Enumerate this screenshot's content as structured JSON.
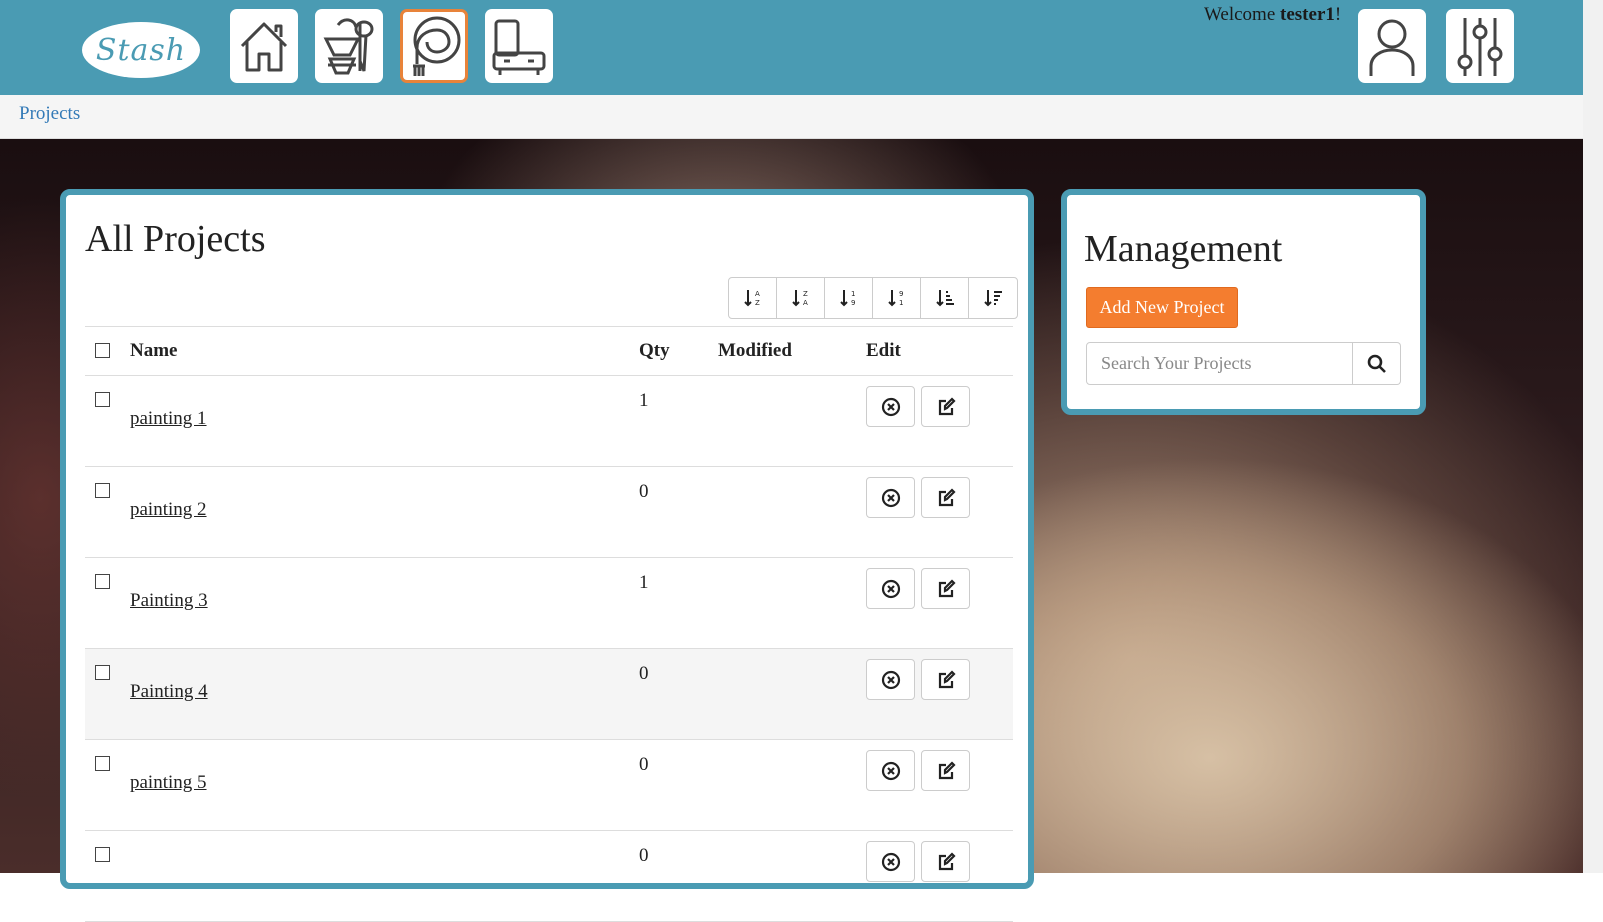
{
  "header": {
    "logo_text": "Stash",
    "nav": [
      {
        "icon": "home-icon",
        "active": false
      },
      {
        "icon": "sewing-supplies-icon",
        "active": false
      },
      {
        "icon": "projects-pattern-icon",
        "active": true
      },
      {
        "icon": "storage-cabinet-icon",
        "active": false
      }
    ],
    "welcome_prefix": "Welcome ",
    "username": "tester1",
    "welcome_suffix": "!",
    "profile_icon": "user-profile-icon",
    "settings_icon": "settings-sliders-icon"
  },
  "breadcrumb": {
    "current": "Projects"
  },
  "projects": {
    "title": "All Projects",
    "sort_buttons": [
      "sort-alpha-asc-icon",
      "sort-alpha-desc-icon",
      "sort-numeric-asc-icon",
      "sort-numeric-desc-icon",
      "sort-amount-asc-icon",
      "sort-amount-desc-icon"
    ],
    "columns": {
      "name": "Name",
      "qty": "Qty",
      "modified": "Modified",
      "edit": "Edit"
    },
    "rows": [
      {
        "name": "painting 1",
        "qty": "1",
        "modified": ""
      },
      {
        "name": "painting 2",
        "qty": "0",
        "modified": ""
      },
      {
        "name": "Painting 3",
        "qty": "1",
        "modified": ""
      },
      {
        "name": "Painting 4",
        "qty": "0",
        "modified": ""
      },
      {
        "name": "painting 5",
        "qty": "0",
        "modified": ""
      },
      {
        "name": "",
        "qty": "0",
        "modified": ""
      }
    ]
  },
  "management": {
    "title": "Management",
    "add_button": "Add New Project",
    "search_placeholder": "Search Your Projects",
    "search_icon": "search-icon"
  },
  "colors": {
    "brand": "#4a9bb3",
    "accent": "#f47d2f",
    "link": "#337ab7"
  }
}
